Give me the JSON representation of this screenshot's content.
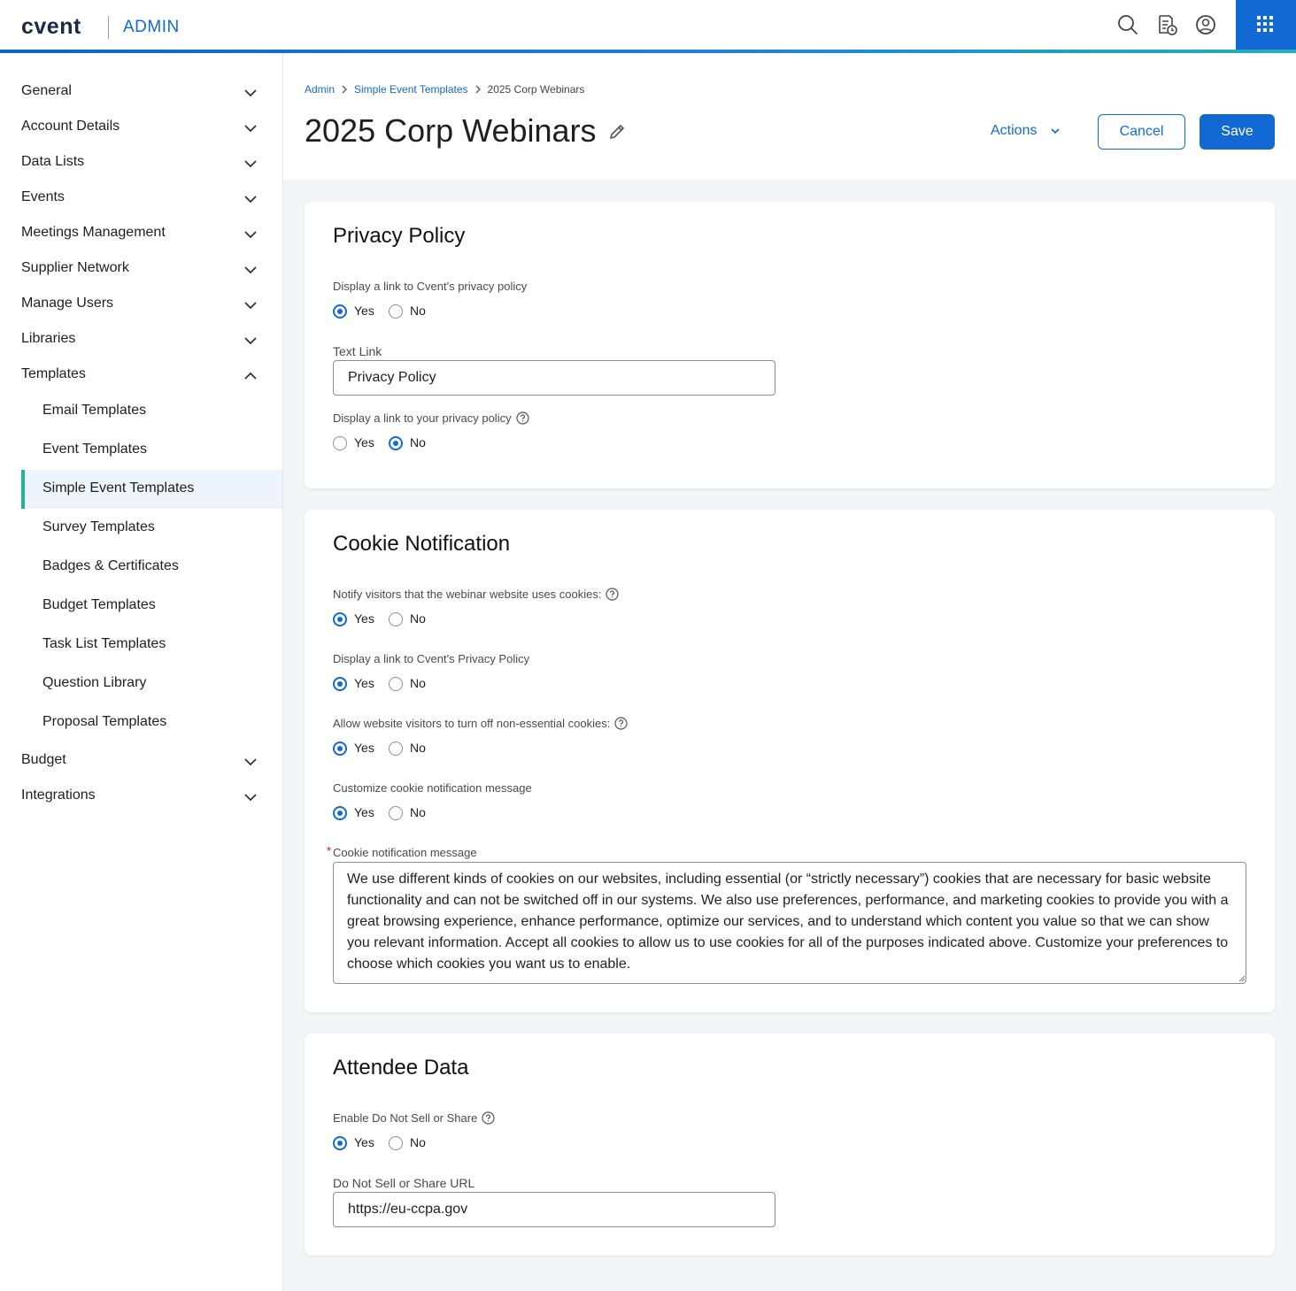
{
  "header": {
    "logo": "cvent",
    "section": "ADMIN",
    "icons": [
      "search-icon",
      "event-schedule-icon",
      "user-profile-icon",
      "app-launcher-icon"
    ]
  },
  "sidebar": {
    "items": [
      {
        "label": "General"
      },
      {
        "label": "Account Details"
      },
      {
        "label": "Data Lists"
      },
      {
        "label": "Events"
      },
      {
        "label": "Meetings Management"
      },
      {
        "label": "Supplier Network"
      },
      {
        "label": "Manage Users"
      },
      {
        "label": "Libraries"
      },
      {
        "label": "Templates",
        "expanded": true
      }
    ],
    "template_children": [
      {
        "label": "Email Templates"
      },
      {
        "label": "Event Templates"
      },
      {
        "label": "Simple Event Templates",
        "active": true
      },
      {
        "label": "Survey Templates"
      },
      {
        "label": "Badges & Certificates"
      },
      {
        "label": "Budget Templates"
      },
      {
        "label": "Task List Templates"
      },
      {
        "label": "Question Library"
      },
      {
        "label": "Proposal Templates"
      }
    ],
    "items_after": [
      {
        "label": "Budget"
      },
      {
        "label": "Integrations"
      }
    ]
  },
  "breadcrumb": [
    "Admin",
    "Simple Event Templates",
    "2025 Corp Webinars"
  ],
  "page": {
    "title": "2025 Corp Webinars",
    "actions_label": "Actions",
    "cancel_label": "Cancel",
    "save_label": "Save"
  },
  "privacy": {
    "title": "Privacy Policy",
    "cvent_link_label": "Display a link to Cvent's privacy policy",
    "cvent_link_value": "Yes",
    "text_link_label": "Text Link",
    "text_link_value": "Privacy Policy",
    "own_link_label": "Display a link to your privacy policy",
    "own_link_value": "No"
  },
  "cookie": {
    "title": "Cookie Notification",
    "notify_label": "Notify visitors that the webinar website uses cookies:",
    "notify_value": "Yes",
    "cvent_policy_label": "Display a link to Cvent's Privacy Policy",
    "cvent_policy_value": "Yes",
    "turn_off_label": "Allow website visitors to turn off non-essential cookies:",
    "turn_off_value": "Yes",
    "customize_label": "Customize cookie notification message",
    "customize_value": "Yes",
    "message_label": "Cookie notification message",
    "required_mark": "*",
    "message_value": "We use different kinds of cookies on our websites, including essential (or “strictly necessary”) cookies that are necessary for basic website functionality and can not be switched off in our systems. We also use preferences, performance, and marketing cookies to provide you with a great browsing experience, enhance performance, optimize our services, and to understand which content you value so that we can show you relevant information. Accept all cookies to allow us to use cookies for all of the purposes indicated above. Customize your preferences to choose which cookies you want us to enable."
  },
  "attendee": {
    "title": "Attendee Data",
    "dnss_label": "Enable Do Not Sell or Share",
    "dnss_value": "Yes",
    "url_label": "Do Not Sell or Share URL",
    "url_value": "https://eu-ccpa.gov"
  },
  "radio_options": {
    "yes": "Yes",
    "no": "No"
  },
  "colors": {
    "accent": "#1269d3",
    "active_indicator": "#26b0a0",
    "content_bg": "#f4f5f7"
  }
}
